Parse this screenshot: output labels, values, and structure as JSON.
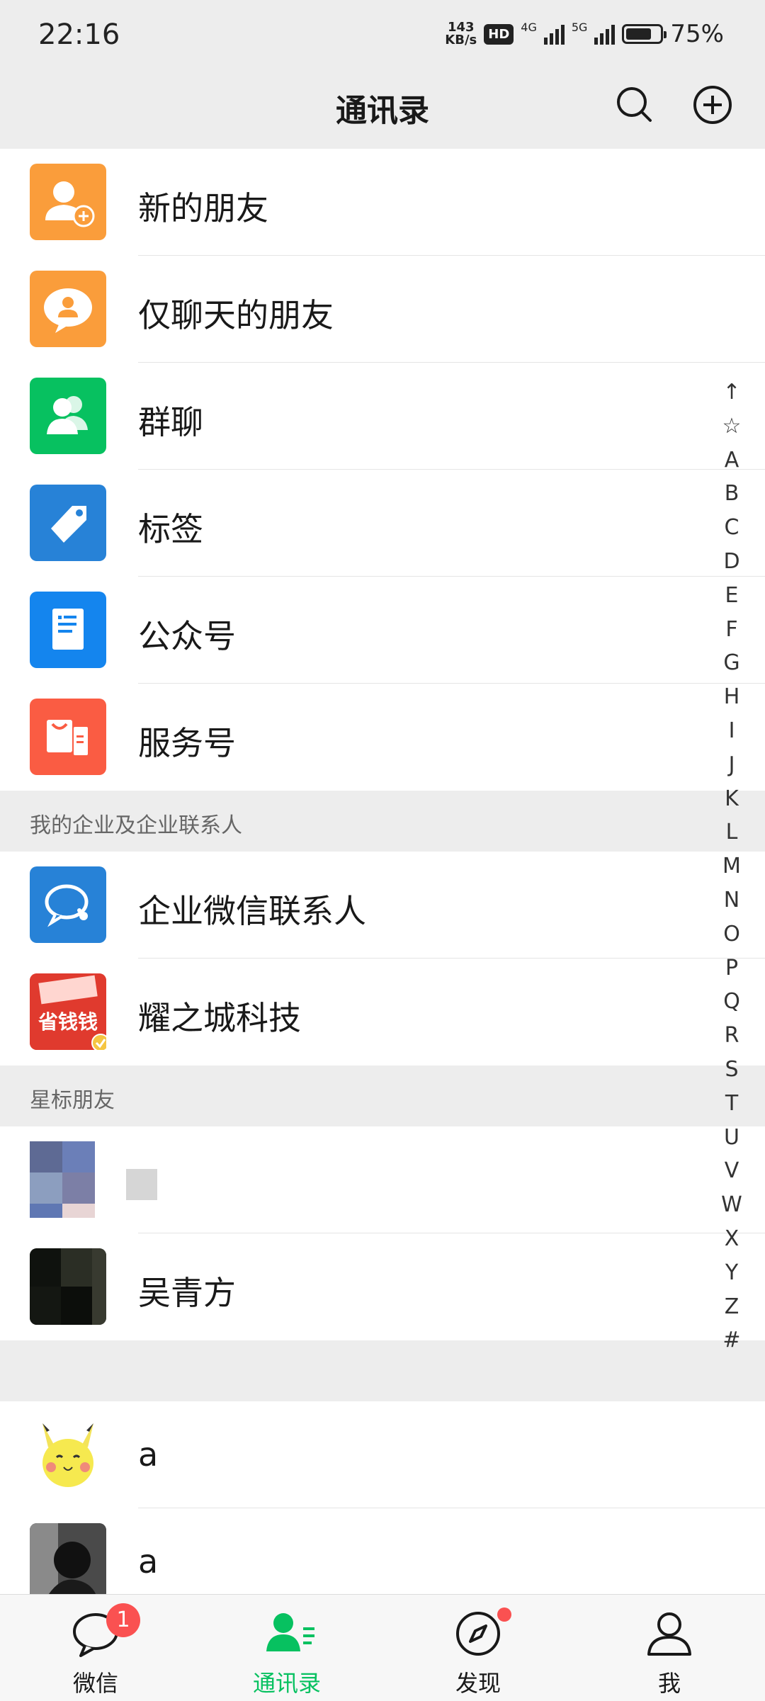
{
  "status": {
    "time": "22:16",
    "speed_top": "143",
    "speed_bottom": "KB/s",
    "hd": "HD",
    "net1": "4G",
    "net2": "5G",
    "battery": "75%",
    "battery_level": 0.75
  },
  "header": {
    "title": "通讯录"
  },
  "top_items": [
    {
      "label": "新的朋友",
      "icon": "add-friend-icon",
      "color": "#fa9d3b"
    },
    {
      "label": "仅聊天的朋友",
      "icon": "chat-only-friend-icon",
      "color": "#fa9d3b"
    },
    {
      "label": "群聊",
      "icon": "group-chat-icon",
      "color": "#07c160"
    },
    {
      "label": "标签",
      "icon": "tag-icon",
      "color": "#2782d7"
    },
    {
      "label": "公众号",
      "icon": "official-account-icon",
      "color": "#1485ee"
    },
    {
      "label": "服务号",
      "icon": "service-account-icon",
      "color": "#fa5c43"
    }
  ],
  "enterprise": {
    "header": "我的企业及企业联系人",
    "items": [
      {
        "label": "企业微信联系人",
        "icon": "enterprise-wechat-icon",
        "color": "#2782d7"
      },
      {
        "label": "耀之城科技",
        "icon": "shop-logo-icon",
        "logo_text": "省钱钱",
        "color": "#e03a2e"
      }
    ]
  },
  "starred": {
    "header": "星标朋友",
    "items": [
      {
        "label": ""
      },
      {
        "label": "吴青方"
      }
    ]
  },
  "contacts": [
    {
      "label": "a",
      "icon": "pikachu-avatar"
    },
    {
      "label": "a",
      "icon": "photo-avatar"
    }
  ],
  "alphabet": [
    "↑",
    "☆",
    "A",
    "B",
    "C",
    "D",
    "E",
    "F",
    "G",
    "H",
    "I",
    "J",
    "K",
    "L",
    "M",
    "N",
    "O",
    "P",
    "Q",
    "R",
    "S",
    "T",
    "U",
    "V",
    "W",
    "X",
    "Y",
    "Z",
    "#"
  ],
  "tabs": [
    {
      "label": "微信",
      "icon": "chat-bubble-icon",
      "badge": "1"
    },
    {
      "label": "通讯录",
      "icon": "contacts-icon",
      "active": true
    },
    {
      "label": "发现",
      "icon": "compass-icon",
      "dot": true
    },
    {
      "label": "我",
      "icon": "person-icon"
    }
  ],
  "colors": {
    "accent": "#07c160",
    "badge": "#fa5151",
    "background": "#ededed"
  }
}
